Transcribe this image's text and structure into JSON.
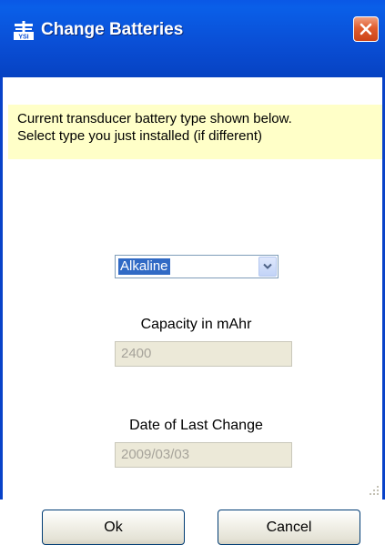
{
  "window": {
    "title": "Change Batteries",
    "icon": "ysi-logo-icon",
    "icon_text": "YSI"
  },
  "notice": {
    "line1": "Current transducer battery type shown below.",
    "line2": "Select type you just installed (if different)"
  },
  "battery_type": {
    "selected": "Alkaline"
  },
  "capacity": {
    "label": "Capacity in mAhr",
    "value": "2400"
  },
  "last_change": {
    "label": "Date of Last Change",
    "value": "2009/03/03"
  },
  "buttons": {
    "ok": "Ok",
    "cancel": "Cancel"
  },
  "colors": {
    "titlebar": "#0a4fd6",
    "close": "#e05d2e",
    "notice_bg": "#ffffc8",
    "selection": "#316ac5"
  }
}
